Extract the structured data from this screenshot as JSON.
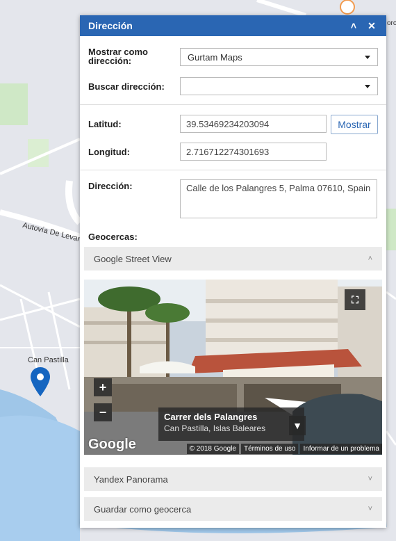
{
  "panel": {
    "title": "Dirección",
    "show_as_label": "Mostrar como dirección:",
    "show_as_value": "Gurtam Maps",
    "search_label": "Buscar dirección:",
    "search_value": "",
    "lat_label": "Latitud:",
    "lat_value": "39.53469234203094",
    "show_button": "Mostrar",
    "lon_label": "Longitud:",
    "lon_value": "2.716712274301693",
    "address_label": "Dirección:",
    "address_value": "Calle de los Palangres 5, Palma 07610, Spain",
    "geofences_label": "Geocercas:"
  },
  "accordion": {
    "street_view": "Google Street View",
    "yandex": "Yandex Panorama",
    "save": "Guardar como geocerca"
  },
  "street_view": {
    "street": "Carrer dels Palangres",
    "locality": "Can Pastilla, Islas Baleares",
    "logo": "Google",
    "copyright": "© 2018 Google",
    "terms": "Términos de uso",
    "report": "Informar de un problema"
  },
  "map": {
    "label_place": "Can Pastilla",
    "label_road": "Autovía De Levante",
    "label_corner": "orc"
  }
}
